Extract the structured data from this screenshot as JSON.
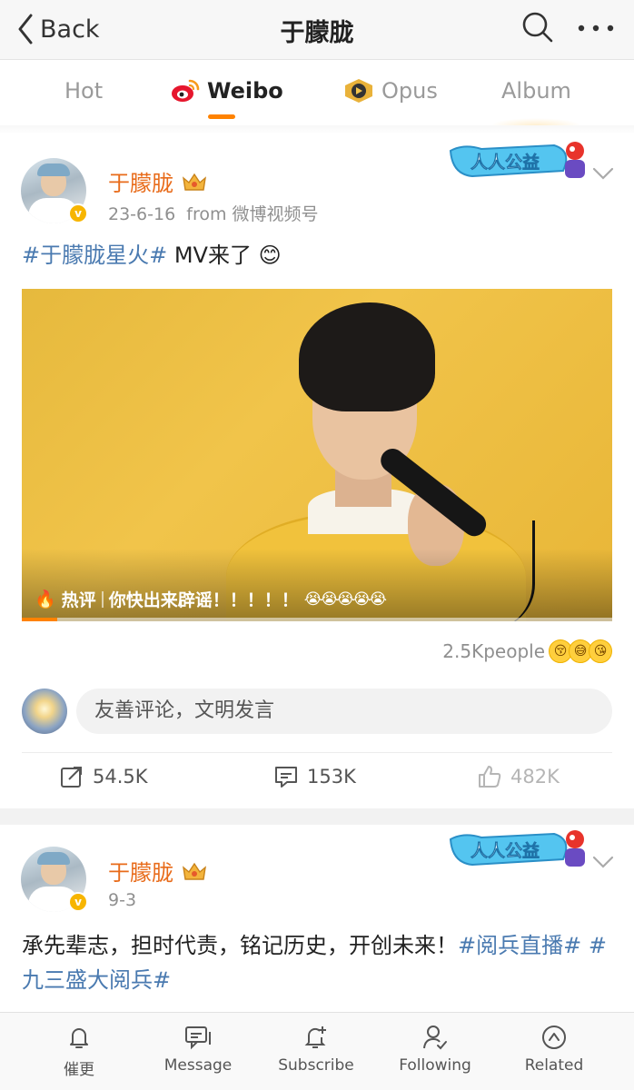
{
  "header": {
    "back_label": "Back",
    "title": "于朦胧"
  },
  "tabs": [
    {
      "label": "Hot"
    },
    {
      "label": "Weibo"
    },
    {
      "label": "Opus"
    },
    {
      "label": "Album"
    }
  ],
  "colors": {
    "accent": "#ff8200",
    "username": "#e86b1a",
    "topic_link": "#4a7ab0",
    "video_bg": "#f1c44a"
  },
  "posts": [
    {
      "username": "于朦胧",
      "date": "23-6-16",
      "source": "from 微博视频号",
      "topic": "#于朦胧星火#",
      "text": " MV来了 ",
      "emoji": "😊",
      "video": {
        "hot_label": "热评",
        "hot_comment": "你快出来辟谣！！！！！",
        "hot_emojis": "😭😭😭😭😭",
        "progress": 0.06
      },
      "people_count": "2.5Kpeople",
      "reaction_emojis": [
        "😚",
        "😅",
        "😘"
      ],
      "comment_placeholder": "友善评论，文明发言",
      "actions": {
        "repost": "54.5K",
        "comment": "153K",
        "like": "482K"
      }
    },
    {
      "username": "于朦胧",
      "date": "9-3",
      "text": "承先辈志，担时代责，铭记历史，开创未来！",
      "topic1": "#阅兵直播#",
      "topic2": "#九三盛大阅兵#"
    }
  ],
  "badges": {
    "charity_text": "人人公益"
  },
  "bottom_bar": [
    {
      "label": "催更",
      "icon": "bell-icon"
    },
    {
      "label": "Message",
      "icon": "chat-icon"
    },
    {
      "label": "Subscribe",
      "icon": "bell-plus-icon"
    },
    {
      "label": "Following",
      "icon": "user-check-icon"
    },
    {
      "label": "Related",
      "icon": "compass-icon"
    }
  ]
}
